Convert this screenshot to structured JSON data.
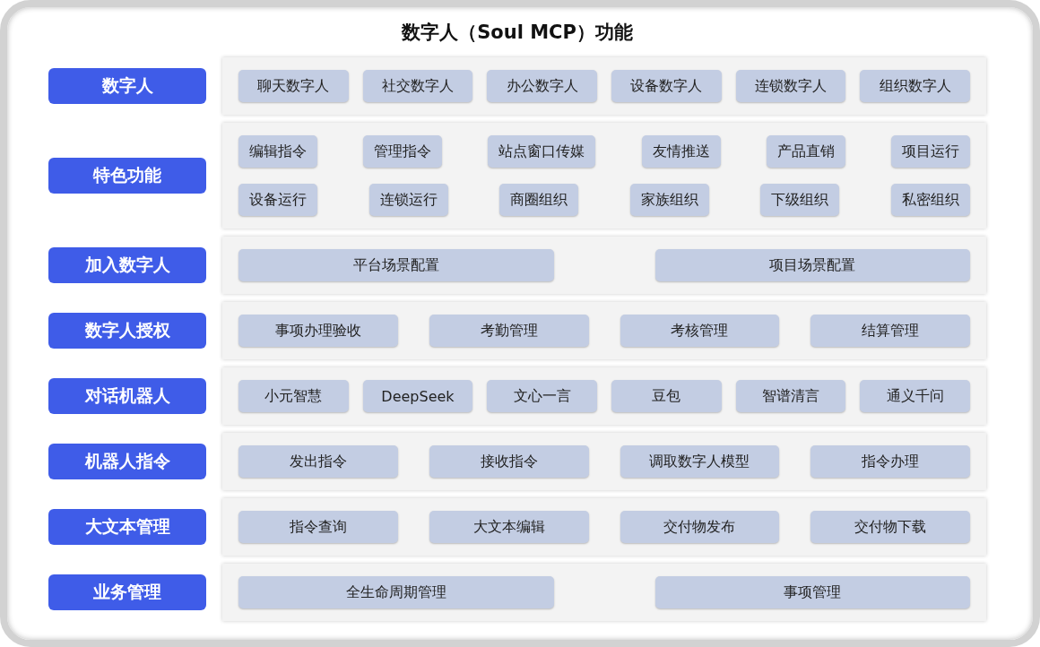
{
  "title": "数字人（Soul MCP）功能",
  "rows": [
    {
      "label": "数字人",
      "kind": "grid",
      "lines": [
        [
          "聊天数字人",
          "社交数字人",
          "办公数字人",
          "设备数字人",
          "连锁数字人",
          "组织数字人"
        ]
      ]
    },
    {
      "label": "特色功能",
      "kind": "flow",
      "lines": [
        [
          "编辑指令",
          "管理指令",
          "站点窗口传媒",
          "友情推送",
          "产品直销",
          "项目运行"
        ],
        [
          "设备运行",
          "连锁运行",
          "商圈组织",
          "家族组织",
          "下级组织",
          "私密组织"
        ]
      ]
    },
    {
      "label": "加入数字人",
      "kind": "grid",
      "lines": [
        [
          "平台场景配置",
          "项目场景配置"
        ]
      ]
    },
    {
      "label": "数字人授权",
      "kind": "grid",
      "lines": [
        [
          "事项办理验收",
          "考勤管理",
          "考核管理",
          "结算管理"
        ]
      ]
    },
    {
      "label": "对话机器人",
      "kind": "grid",
      "lines": [
        [
          "小元智慧",
          "DeepSeek",
          "文心一言",
          "豆包",
          "智谱清言",
          "通义千问"
        ]
      ]
    },
    {
      "label": "机器人指令",
      "kind": "grid",
      "lines": [
        [
          "发出指令",
          "接收指令",
          "调取数字人模型",
          "指令办理"
        ]
      ]
    },
    {
      "label": "大文本管理",
      "kind": "grid",
      "lines": [
        [
          "指令查询",
          "大文本编辑",
          "交付物发布",
          "交付物下载"
        ]
      ]
    },
    {
      "label": "业务管理",
      "kind": "grid",
      "lines": [
        [
          "全生命周期管理",
          "事项管理"
        ]
      ]
    }
  ]
}
